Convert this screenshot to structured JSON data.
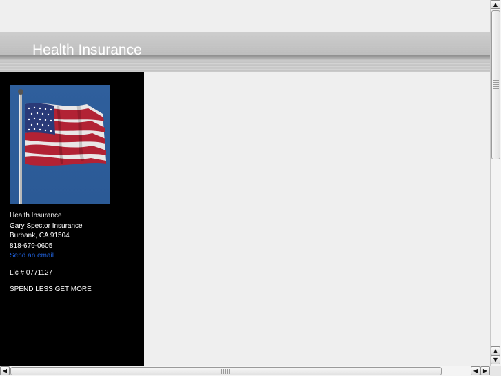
{
  "header": {
    "title": "Health Insurance"
  },
  "sidebar": {
    "lines": [
      "Health Insurance",
      "Gary Spector Insurance",
      "Burbank, CA 91504",
      "818-679-0605"
    ],
    "email_link": "Send an email",
    "license": "Lic # 0771127",
    "slogan": "SPEND LESS GET MORE",
    "image_icon": "american-flag-photo"
  },
  "scrollbars": {
    "up_arrow": "▲",
    "down_arrow": "▼",
    "left_arrow": "◀",
    "right_arrow": "▶"
  },
  "colors": {
    "sidebar_bg": "#000000",
    "link": "#1f5fd6",
    "page_bg": "#efefef"
  }
}
